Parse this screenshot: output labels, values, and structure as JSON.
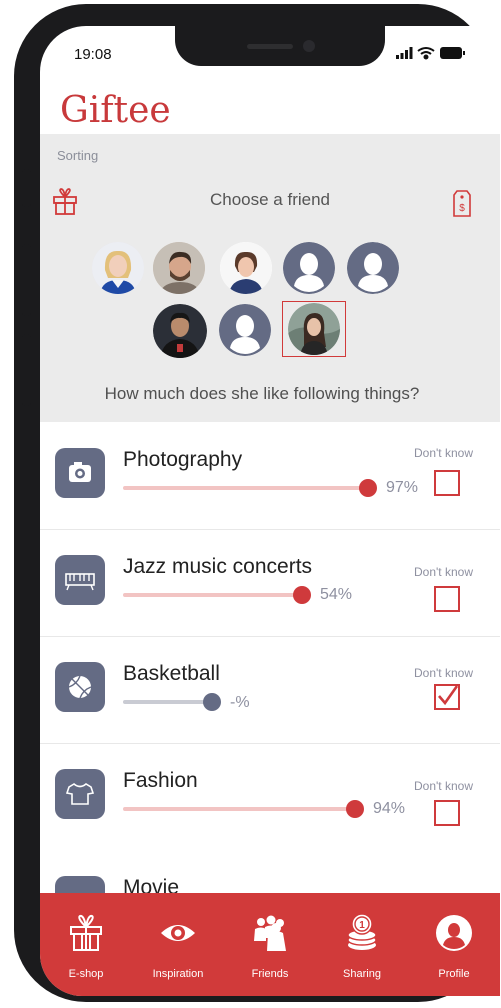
{
  "status_bar": {
    "time": "19:08"
  },
  "app": {
    "title": "Giftee"
  },
  "sorting_label": "Sorting",
  "choose_friend": "Choose a friend",
  "question": "How much does she like following things?",
  "friends": [
    {
      "name": "friend-1",
      "kind": "photo",
      "selected": false
    },
    {
      "name": "friend-2",
      "kind": "photo",
      "selected": false
    },
    {
      "name": "friend-3",
      "kind": "photo",
      "selected": false
    },
    {
      "name": "friend-4",
      "kind": "placeholder",
      "selected": false
    },
    {
      "name": "friend-5",
      "kind": "placeholder",
      "selected": false
    },
    {
      "name": "friend-6",
      "kind": "photo",
      "selected": false
    },
    {
      "name": "friend-7",
      "kind": "placeholder",
      "selected": false
    },
    {
      "name": "friend-8",
      "kind": "photo",
      "selected": true
    }
  ],
  "interests": [
    {
      "label": "Photography",
      "percent_text": "97%",
      "level": 0.97,
      "dont_know_label": "Don't know",
      "dont_know_checked": false,
      "icon": "camera-icon"
    },
    {
      "label": "Jazz music concerts",
      "percent_text": "54%",
      "level": 0.54,
      "dont_know_label": "Don't know",
      "dont_know_checked": false,
      "icon": "keyboard-icon"
    },
    {
      "label": "Basketball",
      "percent_text": "-%",
      "level": 0.34,
      "dont_know_label": "Don't know",
      "dont_know_checked": true,
      "icon": "basketball-icon"
    },
    {
      "label": "Fashion",
      "percent_text": "94%",
      "level": 0.94,
      "dont_know_label": "Don't know",
      "dont_know_checked": false,
      "icon": "shirt-icon"
    },
    {
      "label": "Movie",
      "icon": "movie-icon"
    }
  ],
  "nav": [
    {
      "label": "E-shop",
      "icon": "gift-icon"
    },
    {
      "label": "Inspiration",
      "icon": "eye-icon"
    },
    {
      "label": "Friends",
      "icon": "friends-icon"
    },
    {
      "label": "Sharing",
      "icon": "coins-icon"
    },
    {
      "label": "Profile",
      "icon": "profile-icon"
    }
  ],
  "colors": {
    "accent": "#d13a3a",
    "icon_bg": "#646b84",
    "track": "#f2c4c3",
    "gray_bg": "#ebebeb"
  }
}
